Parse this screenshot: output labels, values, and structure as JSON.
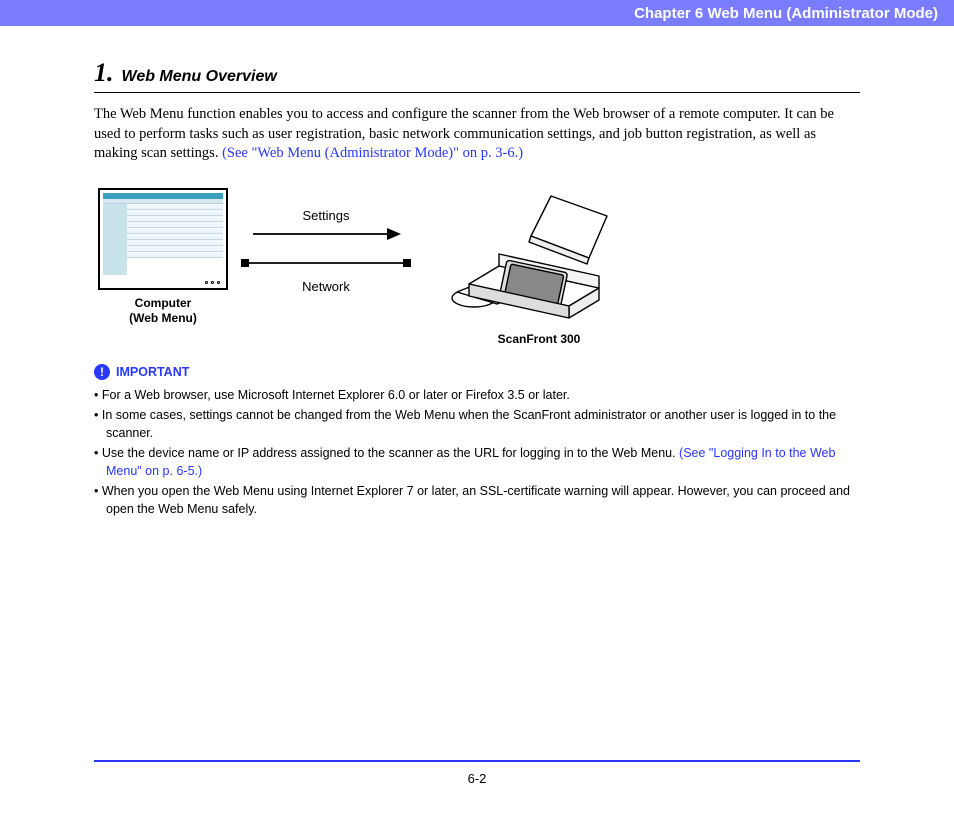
{
  "header": {
    "chapter": "Chapter 6   Web Menu (Administrator Mode)"
  },
  "section": {
    "number": "1.",
    "title": "Web Menu Overview"
  },
  "intro": {
    "text": "The Web Menu function enables you to access and configure the scanner from the Web browser of a remote computer. It can be used to perform tasks such as user registration, basic network communication settings, and job button registration, as well as making scan settings. ",
    "link": "(See \"Web Menu (Administrator Mode)\" on p. 3-6.)"
  },
  "diagram": {
    "settings_label": "Settings",
    "network_label": "Network",
    "computer_caption_l1": "Computer",
    "computer_caption_l2": "(Web Menu)",
    "scanner_caption": "ScanFront 300"
  },
  "important": {
    "icon_glyph": "!",
    "label": "IMPORTANT",
    "bullets": [
      {
        "text": "For a Web browser, use Microsoft Internet Explorer 6.0 or later or Firefox 3.5 or later.",
        "link": ""
      },
      {
        "text": "In some cases, settings cannot be changed from the Web Menu when the ScanFront administrator or another user is logged in to the scanner.",
        "link": ""
      },
      {
        "text": "Use the device name or IP address assigned to the scanner as the URL for logging in to the Web Menu. ",
        "link": "(See \"Logging In to the Web Menu\" on p. 6-5.)"
      },
      {
        "text": "When you open the Web Menu using Internet Explorer 7 or later, an SSL-certificate warning will appear. However, you can proceed and open the Web Menu safely.",
        "link": ""
      }
    ]
  },
  "footer": {
    "page": "6-2"
  }
}
